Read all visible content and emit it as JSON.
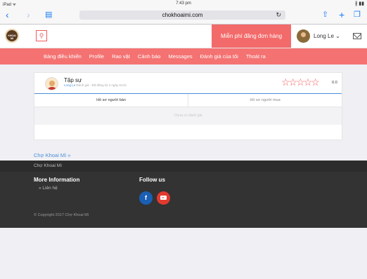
{
  "status_bar": {
    "device": "iPad ᯤ",
    "time": "7:43 pm",
    "battery": "∦ ▮▮"
  },
  "browser": {
    "url": "chokhoaimi.com"
  },
  "header": {
    "logo_text": "KHOAI MI",
    "post_button": "Miễn phí đăng đơn hàng",
    "username": "Long Le"
  },
  "menu": [
    "Bảng điều khiển",
    "Profile",
    "Rao vặt",
    "Cảnh báo",
    "Messages",
    "Đánh giá của tôi",
    "Thoát ra"
  ],
  "profile": {
    "rank": "Tập sự",
    "name": "Long Le",
    "meta": "Đánh giá · Đã đăng ký 2 ngày trước",
    "score": "0.0",
    "stars": "☆☆☆☆☆"
  },
  "tabs": {
    "seller": "Hồ sơ người bán",
    "buyer": "Hồ sơ người mua"
  },
  "empty_message": "Chưa có đánh giá",
  "breadcrumb": "Chợ Khoai Mì »",
  "footer": {
    "site_name": "Chợ Khoai Mì",
    "more_info_title": "More Information",
    "contact_link": "» Liên hệ",
    "follow_title": "Follow us",
    "facebook": "f",
    "copyright": "© Copyright 2017 Chợ Khoai Mì"
  },
  "colors": {
    "accent": "#f47272",
    "link": "#4a8fd8",
    "footer": "#333333"
  }
}
